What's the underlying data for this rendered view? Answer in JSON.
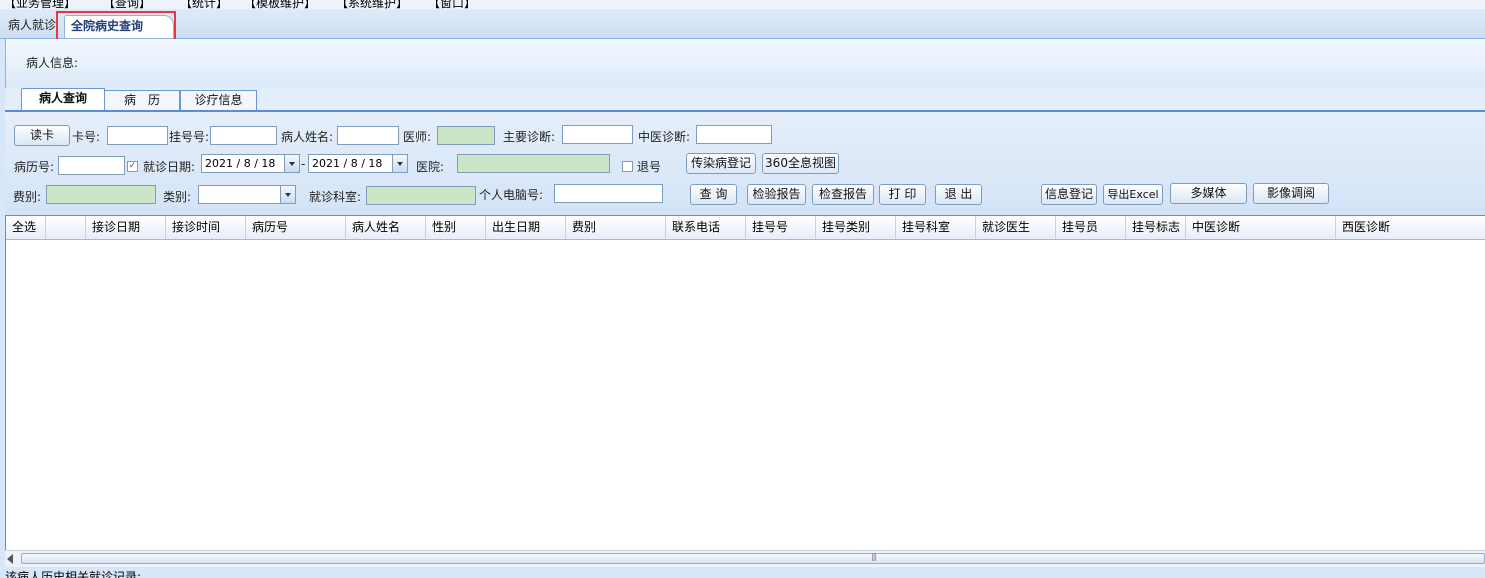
{
  "menubar": {
    "items": [
      "【业务管理】",
      "【查询】",
      "【统计】",
      "【模板维护】",
      "【系统维护】",
      "【窗口】"
    ]
  },
  "doc_tabs": {
    "inactive": "病人就诊",
    "active": "全院病史查询"
  },
  "patient_info": {
    "label": "病人信息:"
  },
  "sub_tabs": [
    "病人查询",
    "病　历",
    "诊疗信息"
  ],
  "form": {
    "read_card": "读卡",
    "card_no": "卡号:",
    "reg_no": "挂号号:",
    "patient_name": "病人姓名:",
    "doctor": "医师:",
    "main_diag": "主要诊断:",
    "tcm_diag": "中医诊断:",
    "record_no": "病历号:",
    "visit_date": "就诊日期:",
    "date_from": "2021 / 8 / 18",
    "date_sep": "-",
    "date_to": "2021 / 8 / 18",
    "hospital": "医院:",
    "refund": "退号",
    "infect_btn": "传染病登记",
    "view360_btn": "360全息视图",
    "fee_type": "费别:",
    "category": "类别:",
    "dept": "就诊科室:",
    "pc_no": "个人电脑号:",
    "query_btn": "查 询",
    "lab_report_btn": "检验报告",
    "exam_report_btn": "检查报告",
    "print_btn": "打 印",
    "exit_btn": "退 出",
    "info_reg_btn": "信息登记",
    "export_btn": "导出Excel",
    "media_btn": "多媒体",
    "image_btn": "影像调阅"
  },
  "grid": {
    "columns": [
      "全选",
      "",
      "接诊日期",
      "接诊时间",
      "病历号",
      "病人姓名",
      "性别",
      "出生日期",
      "费别",
      "联系电话",
      "挂号号",
      "挂号类别",
      "挂号科室",
      "就诊医生",
      "挂号员",
      "挂号标志",
      "中医诊断",
      "西医诊断"
    ]
  },
  "status": {
    "text": "该病人历史相关就诊记录:"
  },
  "colors": {
    "highlight_border": "#e8383d",
    "required_field": "#cbe6c6"
  }
}
